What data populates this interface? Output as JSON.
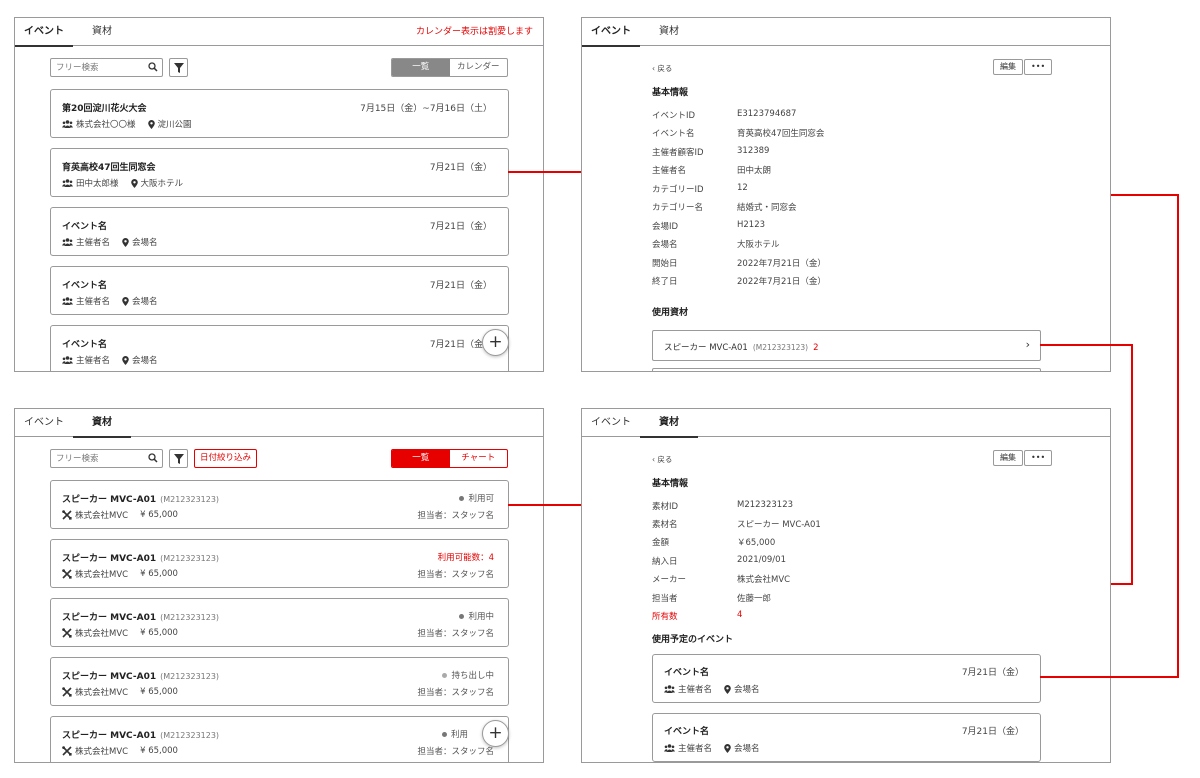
{
  "tabs": {
    "event": "イベント",
    "material": "資材"
  },
  "panel_events": {
    "notice": "カレンダー表示は割愛します",
    "search_placeholder": "フリー検索",
    "toggle": {
      "list": "一覧",
      "calendar": "カレンダー"
    },
    "cards": [
      {
        "title": "第20回淀川花火大会",
        "date": "7月15日（金）~7月16日（土）",
        "organizer": "株式会社〇〇様",
        "venue": "淀川公園"
      },
      {
        "title": "育英高校47回生同窓会",
        "date": "7月21日（金）",
        "organizer": "田中太郎様",
        "venue": "大阪ホテル"
      },
      {
        "title": "イベント名",
        "date": "7月21日（金）",
        "organizer": "主催者名",
        "venue": "会場名"
      },
      {
        "title": "イベント名",
        "date": "7月21日（金）",
        "organizer": "主催者名",
        "venue": "会場名"
      },
      {
        "title": "イベント名",
        "date": "7月21日（金）",
        "organizer": "主催者名",
        "venue": "会場名"
      }
    ],
    "fab": "+"
  },
  "panel_event_detail": {
    "back": "戻る",
    "edit": "編集",
    "more": "•••",
    "basic_info": "基本情報",
    "fields": [
      {
        "k": "イベントID",
        "v": "E3123794687"
      },
      {
        "k": "イベント名",
        "v": "育英高校47回生同窓会"
      },
      {
        "k": "主催者顧客ID",
        "v": "312389"
      },
      {
        "k": "主催者名",
        "v": "田中太朗"
      },
      {
        "k": "カテゴリーID",
        "v": "12"
      },
      {
        "k": "カテゴリー名",
        "v": "結婚式・同窓会"
      },
      {
        "k": "会場ID",
        "v": "H2123"
      },
      {
        "k": "会場名",
        "v": "大阪ホテル"
      },
      {
        "k": "開始日",
        "v": "2022年7月21日（金）"
      },
      {
        "k": "終了日",
        "v": "2022年7月21日（金）"
      }
    ],
    "used_materials": "使用資材",
    "material_row": {
      "name": "スピーカー MVC-A01",
      "code": "(M212323123)",
      "count": "2"
    }
  },
  "panel_materials": {
    "search_placeholder": "フリー検索",
    "date_filter": "日付絞り込み",
    "toggle": {
      "list": "一覧",
      "chart": "チャート"
    },
    "cards": [
      {
        "title": "スピーカー MVC-A01",
        "code": "(M212323123)",
        "maker": "株式会社MVC",
        "price": "¥ 65,000",
        "status": "利用可",
        "staff": "担当者：スタッフ名"
      },
      {
        "title": "スピーカー MVC-A01",
        "code": "(M212323123)",
        "maker": "株式会社MVC",
        "price": "¥ 65,000",
        "status": "利用可能数：4",
        "staff": "担当者：スタッフ名"
      },
      {
        "title": "スピーカー MVC-A01",
        "code": "(M212323123)",
        "maker": "株式会社MVC",
        "price": "¥ 65,000",
        "status": "利用中",
        "staff": "担当者：スタッフ名"
      },
      {
        "title": "スピーカー MVC-A01",
        "code": "(M212323123)",
        "maker": "株式会社MVC",
        "price": "¥ 65,000",
        "status": "持ち出し中",
        "staff": "担当者：スタッフ名"
      },
      {
        "title": "スピーカー MVC-A01",
        "code": "(M212323123)",
        "maker": "株式会社MVC",
        "price": "¥ 65,000",
        "status": "利用",
        "staff": "担当者：スタッフ名"
      }
    ],
    "fab": "+"
  },
  "panel_material_detail": {
    "back": "戻る",
    "edit": "編集",
    "more": "•••",
    "basic_info": "基本情報",
    "fields": [
      {
        "k": "素材ID",
        "v": "M212323123"
      },
      {
        "k": "素材名",
        "v": "スピーカー MVC-A01"
      },
      {
        "k": "金額",
        "v": "￥65,000"
      },
      {
        "k": "納入日",
        "v": "2021/09/01"
      },
      {
        "k": "メーカー",
        "v": "株式会社MVC"
      },
      {
        "k": "担当者",
        "v": "佐藤一郎"
      },
      {
        "k": "所有数",
        "v": "4"
      }
    ],
    "scheduled_events": "使用予定のイベント",
    "events": [
      {
        "title": "イベント名",
        "date": "7月21日（金）",
        "organizer": "主催者名",
        "venue": "会場名"
      },
      {
        "title": "イベント名",
        "date": "7月21日（金）",
        "organizer": "主催者名",
        "venue": "会場名"
      }
    ]
  },
  "colors": {
    "accent": "#e60000",
    "border": "#9a9a9a",
    "text": "#333333"
  }
}
